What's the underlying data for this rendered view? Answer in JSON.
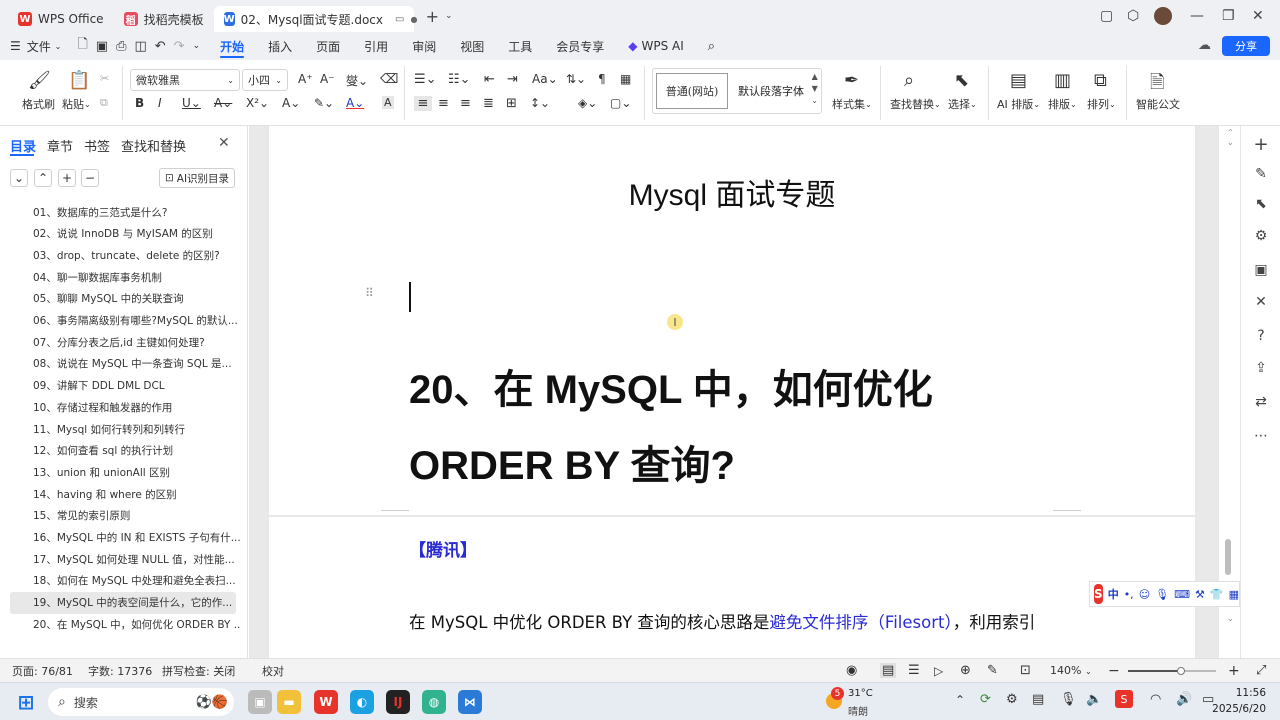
{
  "tabs": [
    {
      "label": "WPS Office"
    },
    {
      "label": "找稻壳模板"
    },
    {
      "label": "02、Mysql面试专题.docx"
    }
  ],
  "menu": [
    "文件",
    "开始",
    "插入",
    "页面",
    "引用",
    "审阅",
    "视图",
    "工具",
    "会员专享",
    "WPS AI"
  ],
  "share_label": "分享",
  "ribbon": {
    "format_painter": "格式刷",
    "paste": "粘贴",
    "font_name": "微软雅黑",
    "font_size": "小四",
    "style_normal": "普通(网站)",
    "style_default": "默认段落字体",
    "style_set": "样式集",
    "find_replace": "查找替换",
    "select": "选择",
    "ai_layout": "AI 排版",
    "layout": "排版",
    "arrange": "排列",
    "smart_doc": "智能公文"
  },
  "sidebar": {
    "tabs": [
      "目录",
      "章节",
      "书签",
      "查找和替换"
    ],
    "ai_toc": "AI识别目录",
    "items": [
      "01、数据库的三范式是什么?",
      "02、说说 InnoDB 与 MyISAM 的区别",
      "03、drop、truncate、delete 的区别?",
      "04、聊一聊数据库事务机制",
      "05、聊聊 MySQL 中的关联查询",
      "06、事务隔离级别有哪些?MySQL 的默认...",
      "07、分库分表之后,id 主键如何处理?",
      "08、说说在 MySQL 中一条查询 SQL 是...",
      "09、讲解下 DDL DML DCL",
      "10、存储过程和触发器的作用",
      "11、Mysql 如何行转列和列转行",
      "12、如何查看 sql 的执行计划",
      "13、union 和 unionAll 区别",
      "14、having 和 where 的区别",
      "15、常见的索引原则",
      "16、MySQL 中的 IN 和 EXISTS 子句有什...",
      "17、MySQL 如何处理 NULL 值，对性能...",
      "18、如何在 MySQL 中处理和避免全表扫...",
      "19、MySQL 中的表空间是什么，它的作...",
      "20、在 MySQL 中，如何优化 ORDER BY ..."
    ]
  },
  "document": {
    "title": "Mysql 面试专题",
    "heading": "20、在 MySQL 中，如何优化 ORDER BY 查询?",
    "tag": "【腾讯】",
    "para_before": "在 MySQL 中优化 ORDER BY 查询的核心思路是",
    "para_link": "避免文件排序（Filesort）",
    "para_after": "，利用索引"
  },
  "ime": {
    "mode": "中"
  },
  "status": {
    "page": "页面: 76/81",
    "words": "字数: 17376",
    "spell": "拼写检查: 关闭",
    "proof": "校对",
    "zoom": "140%"
  },
  "taskbar": {
    "search": "搜索",
    "temp": "31°C",
    "weather": "晴朗",
    "badge": "5",
    "time": "11:56",
    "date": "2025/6/20"
  },
  "colors": {
    "accent": "#1a66ff",
    "wps_red": "#e8332b",
    "link": "#2b2bd6"
  }
}
